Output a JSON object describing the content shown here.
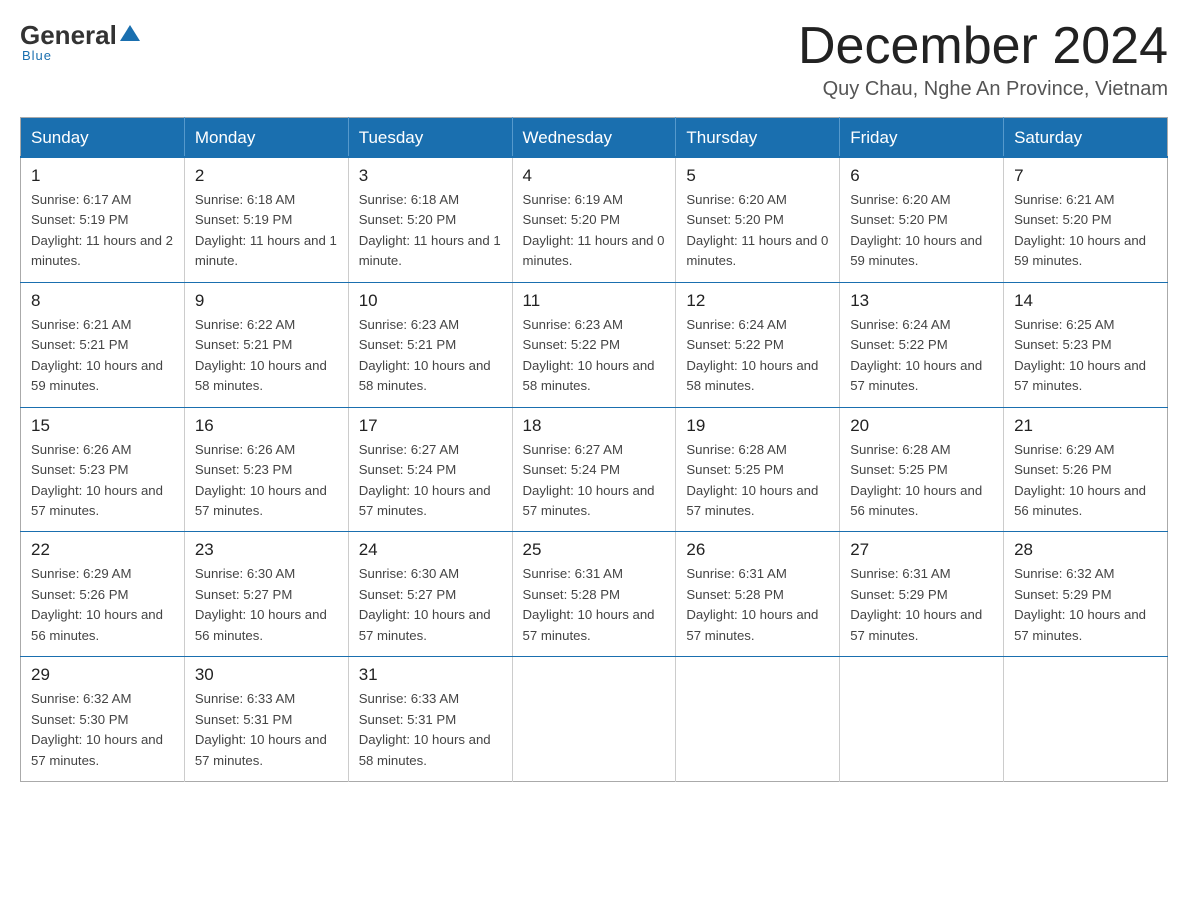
{
  "header": {
    "logo": {
      "text_general": "General",
      "text_blue": "Blue",
      "underline": "Blue"
    },
    "month_title": "December 2024",
    "location": "Quy Chau, Nghe An Province, Vietnam"
  },
  "calendar": {
    "days_of_week": [
      "Sunday",
      "Monday",
      "Tuesday",
      "Wednesday",
      "Thursday",
      "Friday",
      "Saturday"
    ],
    "weeks": [
      [
        {
          "day": "1",
          "sunrise": "6:17 AM",
          "sunset": "5:19 PM",
          "daylight": "11 hours and 2 minutes."
        },
        {
          "day": "2",
          "sunrise": "6:18 AM",
          "sunset": "5:19 PM",
          "daylight": "11 hours and 1 minute."
        },
        {
          "day": "3",
          "sunrise": "6:18 AM",
          "sunset": "5:20 PM",
          "daylight": "11 hours and 1 minute."
        },
        {
          "day": "4",
          "sunrise": "6:19 AM",
          "sunset": "5:20 PM",
          "daylight": "11 hours and 0 minutes."
        },
        {
          "day": "5",
          "sunrise": "6:20 AM",
          "sunset": "5:20 PM",
          "daylight": "11 hours and 0 minutes."
        },
        {
          "day": "6",
          "sunrise": "6:20 AM",
          "sunset": "5:20 PM",
          "daylight": "10 hours and 59 minutes."
        },
        {
          "day": "7",
          "sunrise": "6:21 AM",
          "sunset": "5:20 PM",
          "daylight": "10 hours and 59 minutes."
        }
      ],
      [
        {
          "day": "8",
          "sunrise": "6:21 AM",
          "sunset": "5:21 PM",
          "daylight": "10 hours and 59 minutes."
        },
        {
          "day": "9",
          "sunrise": "6:22 AM",
          "sunset": "5:21 PM",
          "daylight": "10 hours and 58 minutes."
        },
        {
          "day": "10",
          "sunrise": "6:23 AM",
          "sunset": "5:21 PM",
          "daylight": "10 hours and 58 minutes."
        },
        {
          "day": "11",
          "sunrise": "6:23 AM",
          "sunset": "5:22 PM",
          "daylight": "10 hours and 58 minutes."
        },
        {
          "day": "12",
          "sunrise": "6:24 AM",
          "sunset": "5:22 PM",
          "daylight": "10 hours and 58 minutes."
        },
        {
          "day": "13",
          "sunrise": "6:24 AM",
          "sunset": "5:22 PM",
          "daylight": "10 hours and 57 minutes."
        },
        {
          "day": "14",
          "sunrise": "6:25 AM",
          "sunset": "5:23 PM",
          "daylight": "10 hours and 57 minutes."
        }
      ],
      [
        {
          "day": "15",
          "sunrise": "6:26 AM",
          "sunset": "5:23 PM",
          "daylight": "10 hours and 57 minutes."
        },
        {
          "day": "16",
          "sunrise": "6:26 AM",
          "sunset": "5:23 PM",
          "daylight": "10 hours and 57 minutes."
        },
        {
          "day": "17",
          "sunrise": "6:27 AM",
          "sunset": "5:24 PM",
          "daylight": "10 hours and 57 minutes."
        },
        {
          "day": "18",
          "sunrise": "6:27 AM",
          "sunset": "5:24 PM",
          "daylight": "10 hours and 57 minutes."
        },
        {
          "day": "19",
          "sunrise": "6:28 AM",
          "sunset": "5:25 PM",
          "daylight": "10 hours and 57 minutes."
        },
        {
          "day": "20",
          "sunrise": "6:28 AM",
          "sunset": "5:25 PM",
          "daylight": "10 hours and 56 minutes."
        },
        {
          "day": "21",
          "sunrise": "6:29 AM",
          "sunset": "5:26 PM",
          "daylight": "10 hours and 56 minutes."
        }
      ],
      [
        {
          "day": "22",
          "sunrise": "6:29 AM",
          "sunset": "5:26 PM",
          "daylight": "10 hours and 56 minutes."
        },
        {
          "day": "23",
          "sunrise": "6:30 AM",
          "sunset": "5:27 PM",
          "daylight": "10 hours and 56 minutes."
        },
        {
          "day": "24",
          "sunrise": "6:30 AM",
          "sunset": "5:27 PM",
          "daylight": "10 hours and 57 minutes."
        },
        {
          "day": "25",
          "sunrise": "6:31 AM",
          "sunset": "5:28 PM",
          "daylight": "10 hours and 57 minutes."
        },
        {
          "day": "26",
          "sunrise": "6:31 AM",
          "sunset": "5:28 PM",
          "daylight": "10 hours and 57 minutes."
        },
        {
          "day": "27",
          "sunrise": "6:31 AM",
          "sunset": "5:29 PM",
          "daylight": "10 hours and 57 minutes."
        },
        {
          "day": "28",
          "sunrise": "6:32 AM",
          "sunset": "5:29 PM",
          "daylight": "10 hours and 57 minutes."
        }
      ],
      [
        {
          "day": "29",
          "sunrise": "6:32 AM",
          "sunset": "5:30 PM",
          "daylight": "10 hours and 57 minutes."
        },
        {
          "day": "30",
          "sunrise": "6:33 AM",
          "sunset": "5:31 PM",
          "daylight": "10 hours and 57 minutes."
        },
        {
          "day": "31",
          "sunrise": "6:33 AM",
          "sunset": "5:31 PM",
          "daylight": "10 hours and 58 minutes."
        },
        null,
        null,
        null,
        null
      ]
    ]
  }
}
